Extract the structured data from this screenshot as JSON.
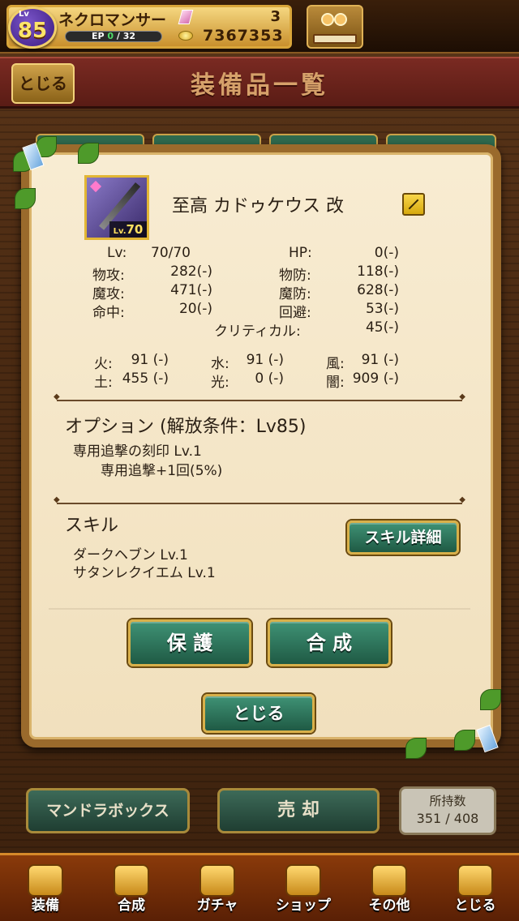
{
  "player": {
    "level_tag": "Lv",
    "level": "85",
    "name": "ネクロマンサー",
    "ep_label": "EP",
    "ep_current": "0",
    "ep_max": "/ 32",
    "ep_fill": 0,
    "gems": "3",
    "gold": "7367353"
  },
  "header": {
    "close_label": "とじる",
    "title": "装備品一覧"
  },
  "item": {
    "name": "至高 カドゥケウス 改",
    "lv_prefix": "Lv.",
    "lv": "70"
  },
  "stats": {
    "lv_label": "Lv:",
    "lv_value": "70/70",
    "hp_label": "HP:",
    "hp_value": "0(-)",
    "patk_label": "物攻:",
    "patk_value": "282(-)",
    "pdef_label": "物防:",
    "pdef_value": "118(-)",
    "matk_label": "魔攻:",
    "matk_value": "471(-)",
    "mdef_label": "魔防:",
    "mdef_value": "628(-)",
    "hit_label": "命中:",
    "hit_value": "20(-)",
    "eva_label": "回避:",
    "eva_value": "53(-)",
    "crit_label": "クリティカル:",
    "crit_value": "45(-)"
  },
  "elements": {
    "fire_label": "火:",
    "fire_value": "91 (-)",
    "water_label": "水:",
    "water_value": "91 (-)",
    "wind_label": "風:",
    "wind_value": "91 (-)",
    "earth_label": "土:",
    "earth_value": "455 (-)",
    "light_label": "光:",
    "light_value": "0 (-)",
    "dark_label": "闇:",
    "dark_value": "909 (-)"
  },
  "option": {
    "heading": "オプション (解放条件：Lv85)",
    "line1": "専用追撃の刻印 Lv.1",
    "line2": "専用追撃+1回(5%)"
  },
  "skill": {
    "heading": "スキル",
    "line1": "ダークヘブン  Lv.1",
    "line2": "サタンレクイエム  Lv.1",
    "detail_button": "スキル詳細"
  },
  "actions": {
    "protect": "保 護",
    "synthesize": "合 成",
    "close": "とじる"
  },
  "bottom_actions": {
    "mandora": "マンドラボックス",
    "sell": "売 却",
    "owned_label": "所持数",
    "owned_value": "351 / 408"
  },
  "nav": [
    {
      "label": "装備",
      "icon": "equipment-icon"
    },
    {
      "label": "合成",
      "icon": "hammer-icon"
    },
    {
      "label": "ガチャ",
      "icon": "gacha-icon"
    },
    {
      "label": "ショップ",
      "icon": "crystal-icon"
    },
    {
      "label": "その他",
      "icon": "gear-icon"
    },
    {
      "label": "とじる",
      "icon": "close-icon"
    }
  ],
  "colors": {
    "accent_gold": "#d9a63a",
    "button_green": "#2f7a5e",
    "panel_cream": "#f5e6c8",
    "header_red": "#6a2419"
  }
}
